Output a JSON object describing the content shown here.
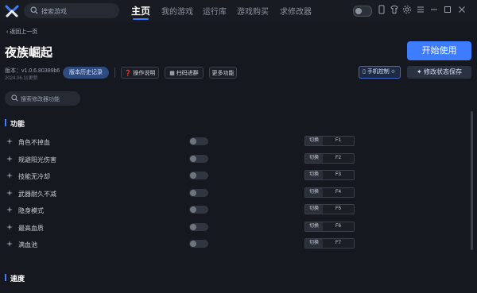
{
  "search": {
    "placeholder": "搜索游戏"
  },
  "nav": [
    {
      "label": "主页"
    },
    {
      "label": "我的游戏"
    },
    {
      "label": "运行库"
    },
    {
      "label": "游戏购买"
    },
    {
      "label": "求修改器"
    }
  ],
  "header": {
    "back_label": "返回上一页",
    "game_title": "夜族崛起",
    "version": "版本：v1.0.6.80389b6",
    "date": "2024.06.11更新"
  },
  "toolbar": {
    "history": "版本历史记录",
    "instructions": "操作说明",
    "scan": "扫码进群",
    "more": "更多功能",
    "mobile": "手机控制",
    "start": "开始使用",
    "save": "修改状态保存"
  },
  "filter": {
    "placeholder": "搜索修改器功能"
  },
  "sections": [
    {
      "title": "功能"
    },
    {
      "title": "速度"
    }
  ],
  "features": [
    {
      "name": "角色不掉血",
      "toggle_label": "切换",
      "key": "F1",
      "enabled": false
    },
    {
      "name": "规避阳光伤害",
      "toggle_label": "切换",
      "key": "F2",
      "enabled": false
    },
    {
      "name": "技能无冷却",
      "toggle_label": "切换",
      "key": "F3",
      "enabled": false
    },
    {
      "name": "武器耐久不减",
      "toggle_label": "切换",
      "key": "F4",
      "enabled": false
    },
    {
      "name": "隐身模式",
      "toggle_label": "切换",
      "key": "F5",
      "enabled": false
    },
    {
      "name": "最高血质",
      "toggle_label": "切换",
      "key": "F6",
      "enabled": false
    },
    {
      "name": "满血池",
      "toggle_label": "切换",
      "key": "F7",
      "enabled": false
    }
  ],
  "colors": {
    "accent": "#3d7bff",
    "background": "#15181f"
  }
}
